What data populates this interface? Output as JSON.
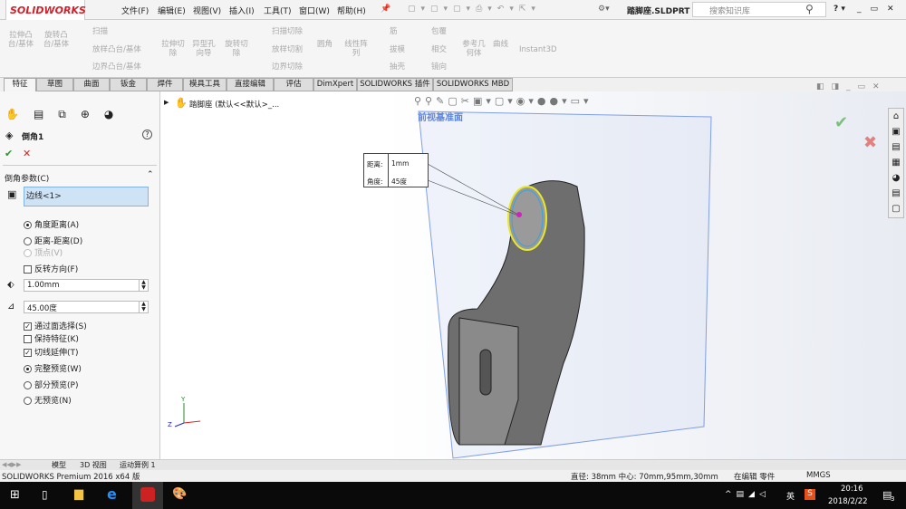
{
  "app": {
    "logo": "SOLIDWORKS",
    "doc_title": "踏脚座.SLDPRT *",
    "search_placeholder": "搜索知识库"
  },
  "menu": [
    "文件(F)",
    "编辑(E)",
    "视图(V)",
    "插入(I)",
    "工具(T)",
    "窗口(W)",
    "帮助(H)"
  ],
  "ribbon": {
    "extrude_boss": "拉伸凸台/基体",
    "revolve_boss": "旋转凸台/基体",
    "sweep": "扫描",
    "loft": "放样凸台/基体",
    "boundary": "边界凸台/基体",
    "extrude_cut": "拉伸切除",
    "hole_wizard": "异型孔向导",
    "revolve_cut": "旋转切除",
    "sweep_cut": "扫描切除",
    "loft_cut": "放样切割",
    "boundary_cut": "边界切除",
    "fillet": "圆角",
    "linear_pattern": "线性阵列",
    "rib": "筋",
    "draft": "拔模",
    "shell": "抽壳",
    "wrap": "包覆",
    "intersect": "相交",
    "mirror": "镜向",
    "ref_geometry": "参考几何体",
    "curves": "曲线",
    "instant3d": "Instant3D"
  },
  "tabs": [
    "特征",
    "草图",
    "曲面",
    "钣金",
    "焊件",
    "模具工具",
    "直接编辑",
    "评估",
    "DimXpert",
    "SOLIDWORKS 插件",
    "SOLIDWORKS MBD"
  ],
  "property": {
    "title": "倒角1",
    "section": "倒角参数(C)",
    "edges": "边线<1>",
    "opt_angle_distance": "角度距离(A)",
    "opt_distance_distance": "距离-距离(D)",
    "opt_vertex": "顶点(V)",
    "reverse": "反转方向(F)",
    "distance": "1.00mm",
    "angle": "45.00度",
    "select_through_faces": "通过面选择(S)",
    "keep_features": "保持特征(K)",
    "tangent_propagation": "切线延伸(T)",
    "full_preview": "完整预览(W)",
    "partial_preview": "部分预览(P)",
    "no_preview": "无预览(N)"
  },
  "tree": {
    "root": "踏脚座 (默认<<默认>_..."
  },
  "viewport": {
    "plane_label": "前视基准面",
    "callout_distance_label": "距离:",
    "callout_distance": "1mm",
    "callout_angle_label": "角度:",
    "callout_angle": "45度"
  },
  "bottom_tabs": [
    "模型",
    "3D 视图",
    "运动算例 1"
  ],
  "status": {
    "left": "SOLIDWORKS Premium 2016 x64 版",
    "right": "直径: 38mm  中心: 70mm,95mm,30mm",
    "mode": "在编辑 零件",
    "units": "MMGS"
  },
  "taskbar": {
    "time": "20:16",
    "date": "2018/2/22",
    "ime": "英",
    "notif": "3"
  }
}
